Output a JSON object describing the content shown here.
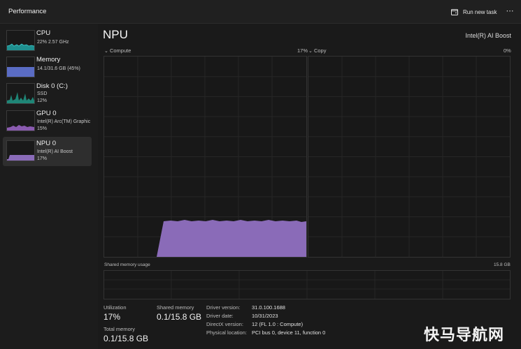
{
  "app": {
    "title": "Performance",
    "run_task_label": "Run new task",
    "more_label": "⋯"
  },
  "sidebar": {
    "items": [
      {
        "name": "CPU",
        "line1": "22%  2.57 GHz",
        "line2": "",
        "color": "#2fb3b3",
        "active": false
      },
      {
        "name": "Memory",
        "line1": "14.1/31.6 GB (45%)",
        "line2": "",
        "color": "#6b7fd7",
        "active": false
      },
      {
        "name": "Disk 0 (C:)",
        "line1": "SSD",
        "line2": "12%",
        "color": "#2fa18f",
        "active": false
      },
      {
        "name": "GPU 0",
        "line1": "Intel(R) Arc(TM) Graphic",
        "line2": "15%",
        "color": "#a673c9",
        "active": false
      },
      {
        "name": "NPU 0",
        "line1": "Intel(R) AI Boost",
        "line2": "17%",
        "color": "#9a78c8",
        "active": true
      }
    ]
  },
  "main": {
    "title": "NPU",
    "device": "Intel(R) AI Boost",
    "compute_label": "Compute",
    "compute_pct": "17%",
    "copy_label": "Copy",
    "copy_pct": "0%",
    "shared_mem_label": "Shared memory usage",
    "shared_mem_max": "15.8 GB",
    "graph_color": "#8a6bb8"
  },
  "stats": {
    "utilization_label": "Utilization",
    "utilization_value": "17%",
    "shared_memory_label": "Shared memory",
    "shared_memory_value": "0.1/15.8 GB",
    "total_memory_label": "Total memory",
    "total_memory_value": "0.1/15.8 GB"
  },
  "info": {
    "rows": [
      {
        "key": "Driver version:",
        "value": "31.0.100.1688"
      },
      {
        "key": "Driver date:",
        "value": "10/31/2023"
      },
      {
        "key": "DirectX version:",
        "value": "12 (FL 1.0 : Compute)"
      },
      {
        "key": "Physical location:",
        "value": "PCI bus 0, device 11, function 0"
      }
    ]
  },
  "watermark": "快马导航网"
}
